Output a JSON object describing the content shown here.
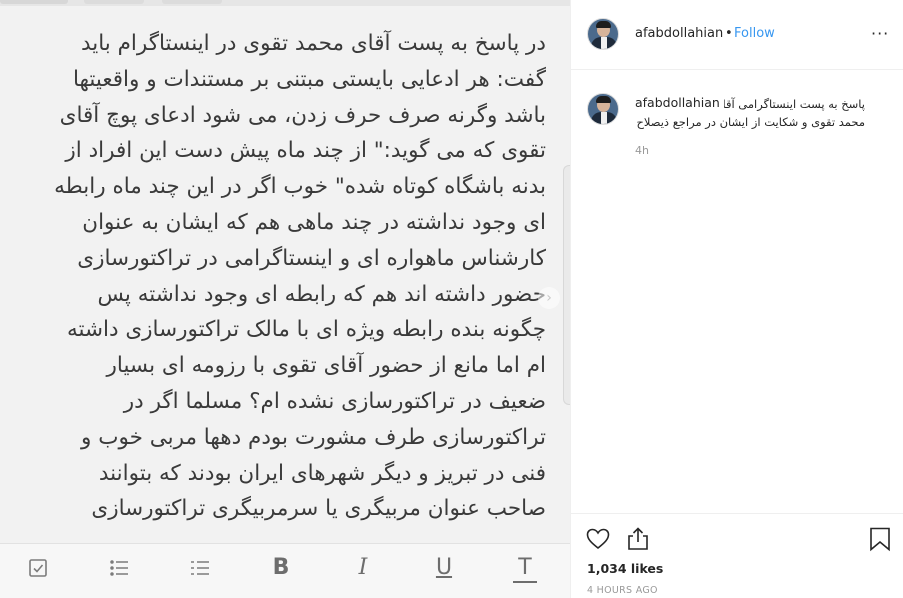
{
  "post_image": {
    "lines": [
      "در پاسخ به پست آقای محمد تقوی در اینستاگرام باید",
      "گفت: هر ادعایی بایستی مبتنی بر مستندات و واقعیتها",
      "باشد وگرنه صرف حرف زدن، می شود ادعای پوچ آقای",
      "تقوی که می گوید:\" از چند ماه پیش دست این افراد از",
      "بدنه باشگاه کوتاه شده\" خوب اگر در این چند ماه رابطه",
      "ای وجود نداشته در چند ماهی هم که ایشان به عنوان",
      "کارشناس ماهواره ای و اینستاگرامی در تراکتورسازی",
      "حضور داشته اند هم که رابطه ای وجود نداشته پس",
      "چگونه بنده رابطه ویژه ای با مالک تراکتورسازی داشته",
      "ام اما مانع از حضور آقای تقوی با رزومه ای بسیار",
      "ضعیف در تراکتورسازی نشده ام؟ مسلما اگر در",
      "تراکتورسازی طرف مشورت بودم دهها مربی خوب و",
      "فنی در تبریز و دیگر شهرهای ایران بودند که بتوانند",
      "صاحب عنوان مربیگری یا سرمربیگری تراکتورسازی"
    ],
    "next_arrow": "›",
    "toolbar": {
      "bold_label": "B",
      "italic_label": "I",
      "underline_label": "U",
      "text_label": "T"
    }
  },
  "header": {
    "username": "afabdollahian",
    "separator": "•",
    "follow_label": "Follow",
    "more_label": "···"
  },
  "caption": {
    "username": "afabdollahian",
    "line1": "پاسخ به پست اینستاگرامی آقای",
    "line2": "محمد تقوی و شکایت از ایشان در مراجع ذیصلاح",
    "time": "4h"
  },
  "footer": {
    "likes": "1,034 likes",
    "timestamp": "4 HOURS AGO"
  },
  "colors": {
    "link": "#3897f0",
    "text": "#262626",
    "muted": "#999999",
    "note_bg": "#f2f2f2"
  },
  "icons": [
    "heart-icon",
    "share-icon",
    "bookmark-icon",
    "more-icon",
    "checkbox-icon",
    "bulleted-list-icon",
    "numbered-list-icon"
  ]
}
